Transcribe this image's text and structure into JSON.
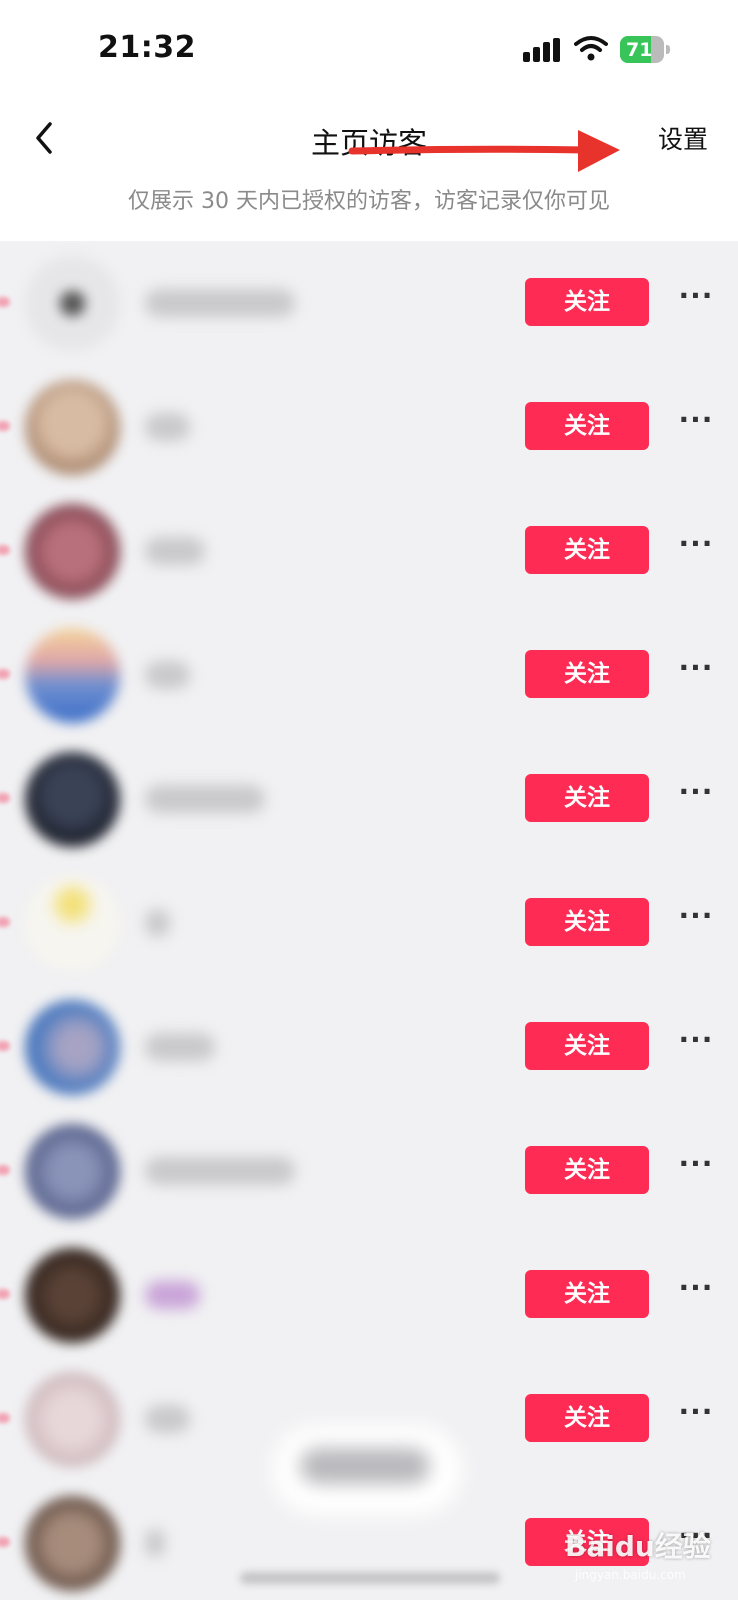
{
  "status_bar": {
    "time": "21:32",
    "battery": "71"
  },
  "header": {
    "back_icon": "chevron-left-icon",
    "title": "主页访客",
    "settings_label": "设置",
    "subtitle": "仅展示 30 天内已授权的访客，访客记录仅你可见",
    "annotation": "red-arrow-pointing-to-settings"
  },
  "visitors": [
    {
      "follow_label": "关注",
      "more_label": "···"
    },
    {
      "follow_label": "关注",
      "more_label": "···"
    },
    {
      "follow_label": "关注",
      "more_label": "···"
    },
    {
      "follow_label": "关注",
      "more_label": "···"
    },
    {
      "follow_label": "关注",
      "more_label": "···"
    },
    {
      "follow_label": "关注",
      "more_label": "···"
    },
    {
      "follow_label": "关注",
      "more_label": "···"
    },
    {
      "follow_label": "关注",
      "more_label": "···"
    },
    {
      "follow_label": "关注",
      "more_label": "···"
    },
    {
      "follow_label": "关注",
      "more_label": "···"
    },
    {
      "follow_label": "关注",
      "more_label": "···"
    }
  ],
  "watermark": {
    "text": "Baidu经验",
    "sub": "jingyan.baidu.com"
  },
  "colors": {
    "accent": "#fe2c55",
    "arrow": "#e8332d",
    "battery": "#37c559",
    "list_bg": "#f1f1f3"
  }
}
